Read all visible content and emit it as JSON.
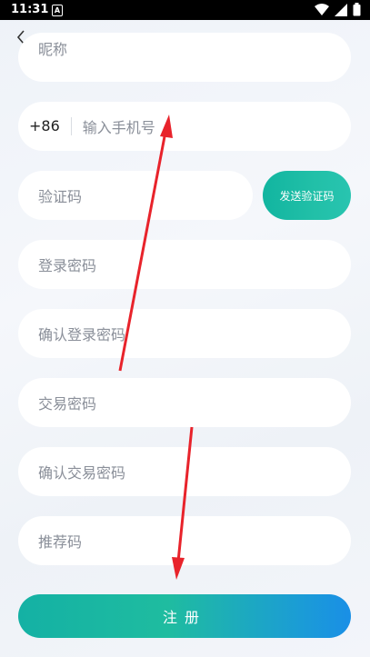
{
  "status_bar": {
    "time": "11:31",
    "notification": "A",
    "icons": [
      "wifi-icon",
      "signal-icon",
      "battery-icon"
    ]
  },
  "form": {
    "nickname_placeholder": "昵称",
    "country_code": "+86",
    "phone_placeholder": "输入手机号",
    "code_placeholder": "验证码",
    "send_code_label": "发送验证码",
    "login_password_placeholder": "登录密码",
    "confirm_login_password_placeholder": "确认登录密码",
    "trade_password_placeholder": "交易密码",
    "confirm_trade_password_placeholder": "确认交易密码",
    "referral_placeholder": "推荐码",
    "register_label": "注册"
  },
  "colors": {
    "accent_teal": "#1fbca0",
    "accent_blue": "#1a8fe6",
    "annotation_red": "#e8232b"
  }
}
